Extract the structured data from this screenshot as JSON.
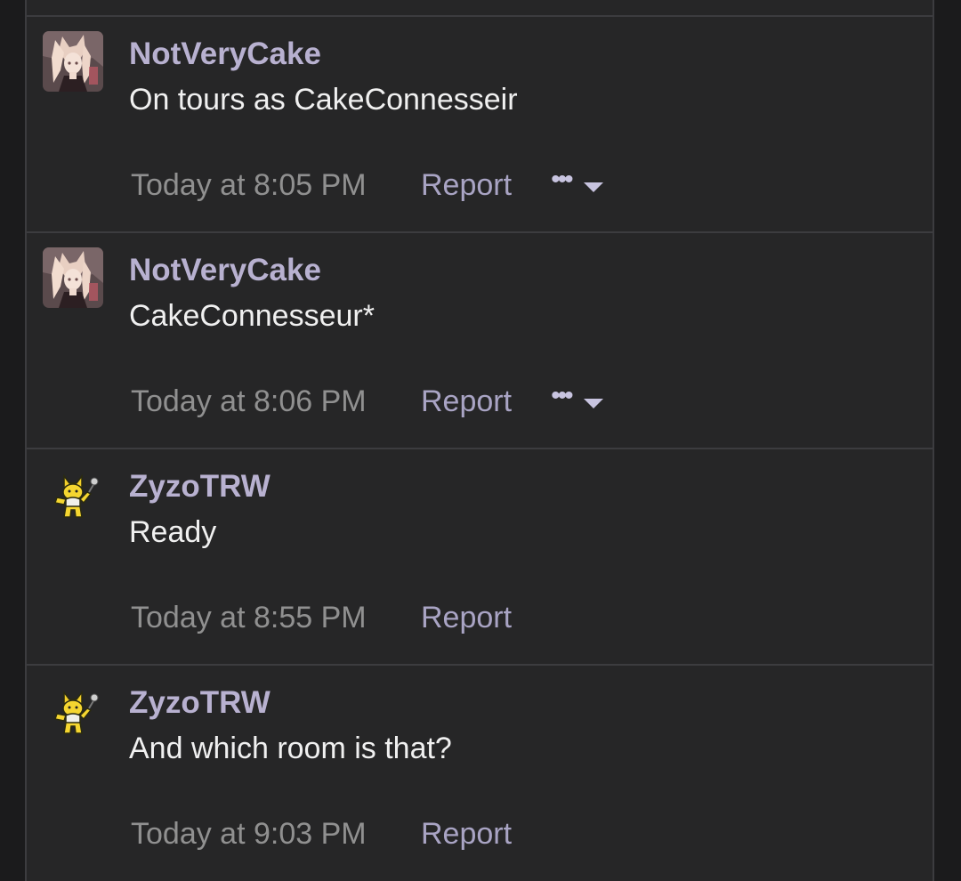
{
  "posts": [
    {
      "avatar": "anime-girl-avatar",
      "username": "NotVeryCake",
      "message": "On tours as CakeConnesseir",
      "time": "Today at 8:05 PM",
      "report_label": "Report",
      "has_more_menu": true
    },
    {
      "avatar": "anime-girl-avatar",
      "username": "NotVeryCake",
      "message": "CakeConnesseur*",
      "time": "Today at 8:06 PM",
      "report_label": "Report",
      "has_more_menu": true
    },
    {
      "avatar": "hypno-sprite-avatar",
      "username": "ZyzoTRW",
      "message": "Ready",
      "time": "Today at 8:55 PM",
      "report_label": "Report",
      "has_more_menu": false
    },
    {
      "avatar": "hypno-sprite-avatar",
      "username": "ZyzoTRW",
      "message": "And which room is that?",
      "time": "Today at 9:03 PM",
      "report_label": "Report",
      "has_more_menu": false
    }
  ],
  "more_menu": {
    "dots": "•••",
    "icon": "caret-down-icon"
  },
  "colors": {
    "background": "#262627",
    "username": "#b8b1d0",
    "message": "#f0f0f0",
    "timestamp": "#909090",
    "report": "#a9a4c4"
  }
}
